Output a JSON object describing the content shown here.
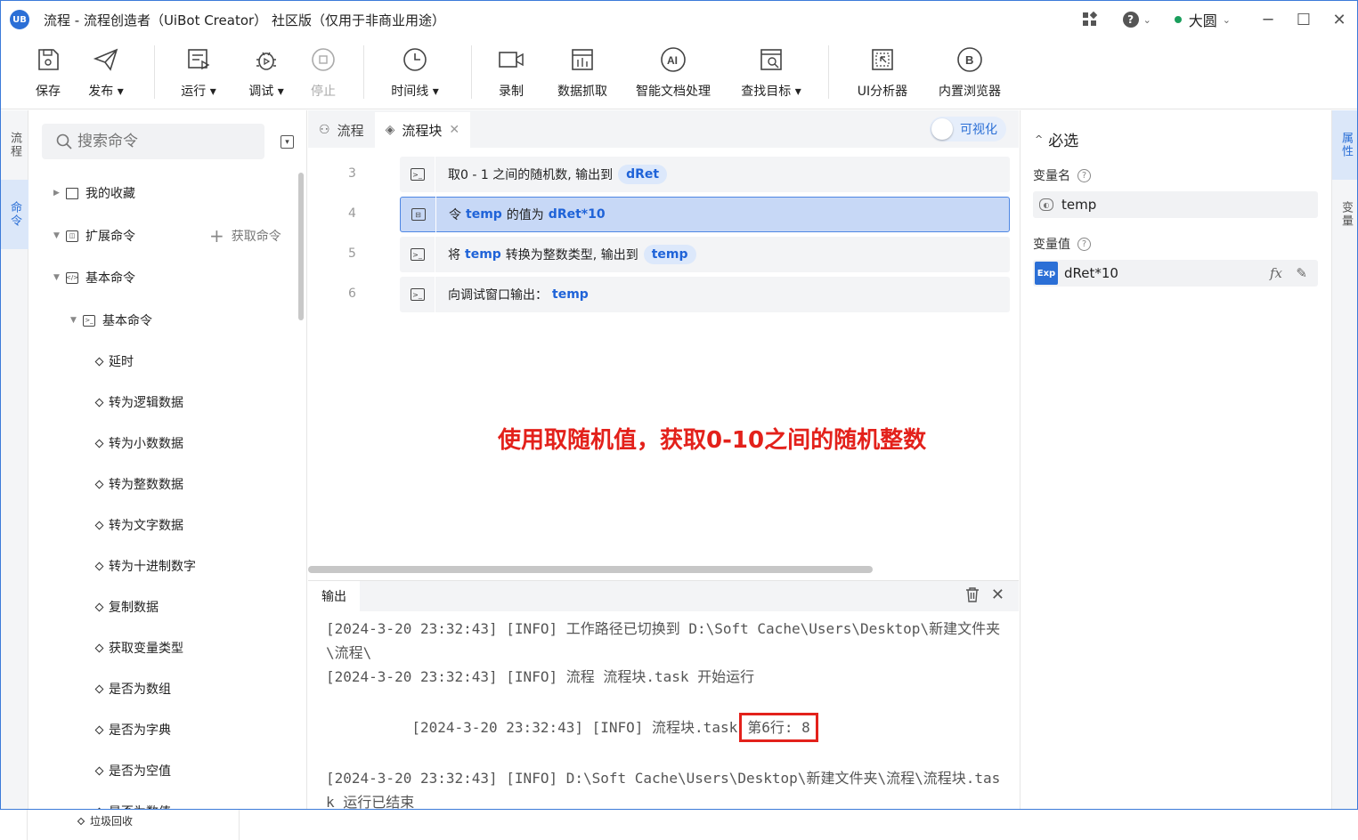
{
  "window": {
    "title": "流程 - 流程创造者（UiBot Creator） 社区版（仅用于非商业用途）",
    "logo_text": "UB",
    "user": "大圆",
    "status_color": "#1a9e5c"
  },
  "toolbar": {
    "items": [
      {
        "label": "保存",
        "icon": "save-icon"
      },
      {
        "label": "发布 ▾",
        "icon": "publish-icon"
      },
      {
        "label": "运行 ▾",
        "icon": "run-icon"
      },
      {
        "label": "调试 ▾",
        "icon": "debug-icon"
      },
      {
        "label": "停止",
        "icon": "stop-icon"
      },
      {
        "label": "时间线 ▾",
        "icon": "timeline-icon"
      },
      {
        "label": "录制",
        "icon": "record-icon"
      },
      {
        "label": "数据抓取",
        "icon": "data-scrape-icon"
      },
      {
        "label": "智能文档处理",
        "icon": "ai-doc-icon"
      },
      {
        "label": "查找目标 ▾",
        "icon": "find-target-icon"
      },
      {
        "label": "UI分析器",
        "icon": "ui-analyzer-icon"
      },
      {
        "label": "内置浏览器",
        "icon": "browser-icon"
      }
    ]
  },
  "left_tabs": [
    "流程",
    "命令"
  ],
  "right_tabs": [
    "属性",
    "变量"
  ],
  "commands": {
    "search_placeholder": "搜索命令",
    "favorites": "我的收藏",
    "extensions": "扩展命令",
    "get_commands": "获取命令",
    "basic": "基本命令",
    "basic_sub": "基本命令",
    "leaves": [
      "延时",
      "转为逻辑数据",
      "转为小数数据",
      "转为整数数据",
      "转为文字数据",
      "转为十进制数字",
      "复制数据",
      "获取变量类型",
      "是否为数组",
      "是否为字典",
      "是否为空值",
      "是否为数值"
    ]
  },
  "editor": {
    "tabs": [
      "流程",
      "流程块"
    ],
    "toggle_label": "可视化",
    "rows": [
      {
        "line": "3",
        "pre": "取0 - 1 之间的随机数, 输出到",
        "pill": "dRet"
      },
      {
        "line": "4",
        "pre": "令",
        "kw1": "temp",
        "mid": "的值为",
        "kw2": "dRet*10"
      },
      {
        "line": "5",
        "pre": "将",
        "kw1": "temp",
        "mid": "转换为整数类型, 输出到",
        "pill": "temp"
      },
      {
        "line": "6",
        "pre": "向调试窗口输出：",
        "kw1": "temp"
      }
    ],
    "annotation": "使用取随机值，获取0-10之间的随机整数"
  },
  "output": {
    "title": "输出",
    "lines": [
      "[2024-3-20 23:32:43] [INFO] 工作路径已切换到 D:\\Soft Cache\\Users\\Desktop\\新建文件夹\\流程\\",
      "[2024-3-20 23:32:43] [INFO] 流程 流程块.task 开始运行",
      "[2024-3-20 23:32:43] [INFO] 流程块.task",
      "[2024-3-20 23:32:43] [INFO] D:\\Soft Cache\\Users\\Desktop\\新建文件夹\\流程\\流程块.task 运行已结束"
    ],
    "highlight": "第6行: 8"
  },
  "properties": {
    "section": "必选",
    "var_name_label": "变量名",
    "var_name_value": "temp",
    "var_value_label": "变量值",
    "var_value_badge": "Exp",
    "var_value": "dRet*10",
    "fx_label": "fx"
  },
  "background": {
    "trash_label": "垃圾回收"
  }
}
